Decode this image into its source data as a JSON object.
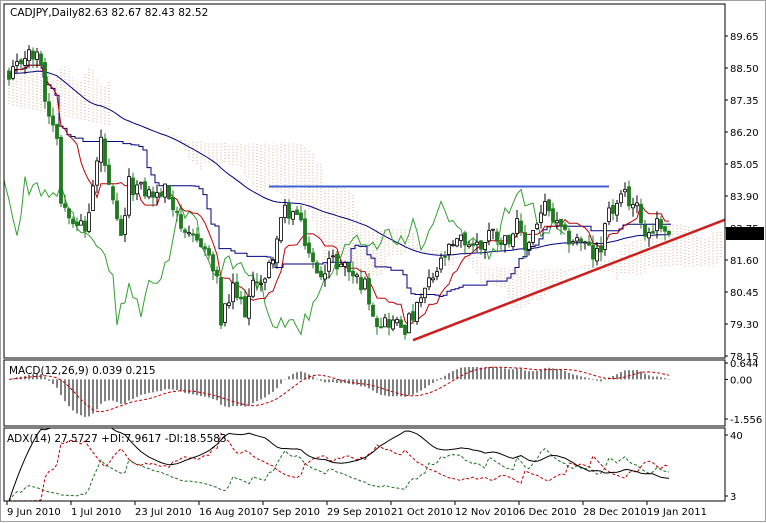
{
  "header": {
    "symbol_timeframe": "CADJPY,Daily",
    "ohlc": "82.63 82.67 82.43 82.52"
  },
  "price_axis": {
    "ticks": [
      "89.65",
      "88.50",
      "87.35",
      "86.20",
      "85.05",
      "83.90",
      "82.75",
      "81.60",
      "80.45",
      "79.30",
      "78.15"
    ],
    "current_price": "82.52"
  },
  "macd": {
    "label": "MACD(12,26,9) 0.039 0.215",
    "ticks": [
      "0.644",
      "0.00",
      "-1.556"
    ]
  },
  "adx": {
    "label": "ADX(14) 27.5727 +DI:7.9617 -DI:18.5583",
    "ticks": [
      "40",
      "3"
    ]
  },
  "time_axis": {
    "labels": [
      "9 Jun 2010",
      "1 Jul 2010",
      "23 Jul 2010",
      "16 Aug 2010",
      "7 Sep 2010",
      "29 Sep 2010",
      "21 Oct 2010",
      "12 Nov 2010",
      "6 Dec 2010",
      "28 Dec 2010",
      "19 Jan 2011"
    ]
  },
  "colors": {
    "bull_body": "#ffffff",
    "bear_body": "#1f7a1f",
    "tenkan": "#c00000",
    "kijun": "#000080",
    "chikou": "#33a033",
    "cloud": "#d8a888",
    "ma": "#000080",
    "resistance": "#4060d0",
    "trendline": "#cc2020"
  },
  "chart_data": {
    "type": "candlestick",
    "title": "CADJPY,Daily",
    "ylim": [
      78.15,
      89.65
    ],
    "bars": 166,
    "last_bar": {
      "open": 82.63,
      "high": 82.67,
      "low": 82.43,
      "close": 82.52
    },
    "close_path": [
      [
        0,
        88.0
      ],
      [
        4,
        89.0
      ],
      [
        8,
        88.8
      ],
      [
        9,
        87.3
      ],
      [
        12,
        86.2
      ],
      [
        13,
        83.7
      ],
      [
        15,
        83.4
      ],
      [
        19,
        82.6
      ],
      [
        23,
        85.9
      ],
      [
        25,
        84.1
      ],
      [
        28,
        82.3
      ],
      [
        30,
        84.3
      ],
      [
        37,
        83.9
      ],
      [
        39,
        84.1
      ],
      [
        42,
        83.4
      ],
      [
        44,
        82.3
      ],
      [
        48,
        82.3
      ],
      [
        50,
        81.7
      ],
      [
        52,
        80.8
      ],
      [
        53,
        79.4
      ],
      [
        56,
        80.5
      ],
      [
        59,
        79.8
      ],
      [
        62,
        81.0
      ],
      [
        64,
        80.8
      ],
      [
        69,
        83.4
      ],
      [
        72,
        83.2
      ],
      [
        74,
        82.3
      ],
      [
        77,
        81.0
      ],
      [
        80,
        81.6
      ],
      [
        84,
        81.4
      ],
      [
        87,
        80.9
      ],
      [
        89,
        80.7
      ],
      [
        92,
        79.4
      ],
      [
        95,
        79.4
      ],
      [
        99,
        79.2
      ],
      [
        102,
        79.8
      ],
      [
        104,
        80.5
      ],
      [
        107,
        81.2
      ],
      [
        109,
        81.75
      ],
      [
        113,
        82.3
      ],
      [
        118,
        82.1
      ],
      [
        120,
        82.65
      ],
      [
        124,
        82.3
      ],
      [
        127,
        82.8
      ],
      [
        129,
        82.0
      ],
      [
        132,
        83.0
      ],
      [
        134,
        83.5
      ],
      [
        137,
        82.8
      ],
      [
        139,
        82.4
      ],
      [
        143,
        82.3
      ],
      [
        146,
        81.75
      ],
      [
        148,
        81.9
      ],
      [
        149,
        83.2
      ],
      [
        152,
        83.5
      ],
      [
        154,
        83.9
      ],
      [
        156,
        83.6
      ],
      [
        158,
        83.2
      ],
      [
        159,
        82.5
      ],
      [
        162,
        83.0
      ],
      [
        165,
        82.52
      ]
    ],
    "resistance_line": {
      "price": 84.24,
      "from_bar": 65,
      "to_bar": 150
    },
    "trend_line": {
      "from": [
        101,
        78.72
      ],
      "to_bar_price_at_axis": 83.05
    },
    "indicators": [
      "Ichimoku(9,26,52)",
      "Moving Average",
      "MACD(12,26,9)",
      "ADX(14)"
    ],
    "macd_ylim": [
      -1.556,
      0.644
    ],
    "adx_ylim": [
      3,
      40
    ]
  }
}
